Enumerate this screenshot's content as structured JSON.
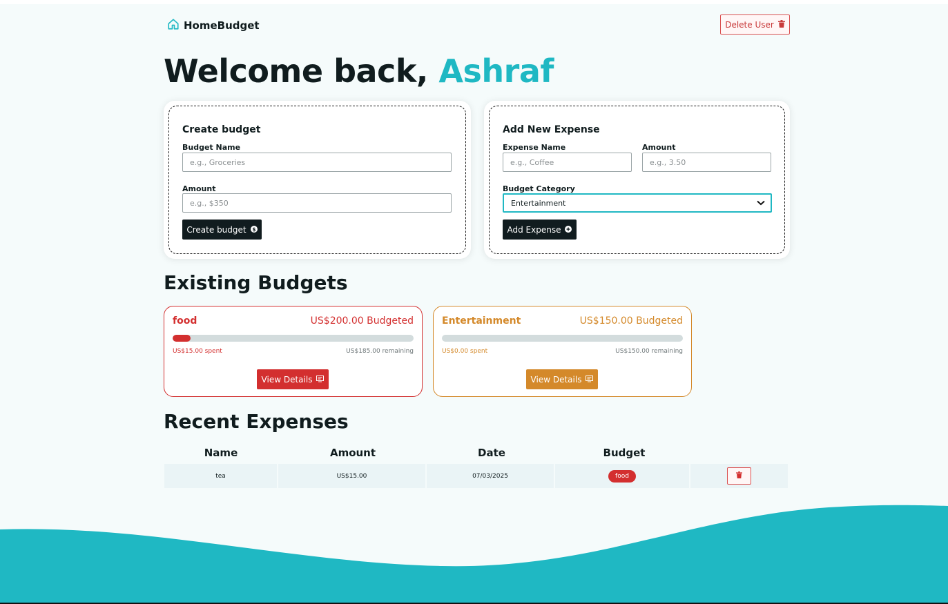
{
  "app": {
    "brand": "HomeBudget",
    "accent_color": "#1fb8c3"
  },
  "header": {
    "delete_user_label": "Delete User"
  },
  "welcome": {
    "prefix": "Welcome back,",
    "user_name": "Ashraf"
  },
  "create_budget": {
    "title": "Create budget",
    "name_label": "Budget Name",
    "name_placeholder": "e.g., Groceries",
    "amount_label": "Amount",
    "amount_placeholder": "e.g., $350",
    "submit_label": "Create budget"
  },
  "add_expense": {
    "title": "Add New Expense",
    "name_label": "Expense Name",
    "name_placeholder": "e.g., Coffee",
    "amount_label": "Amount",
    "amount_placeholder": "e.g., 3.50",
    "category_label": "Budget Category",
    "category_selected": "Entertainment",
    "submit_label": "Add Expense"
  },
  "existing_budgets": {
    "heading": "Existing Budgets",
    "budgets": [
      {
        "name": "food",
        "budgeted": "US$200.00 Budgeted",
        "spent": "US$15.00 spent",
        "remaining": "US$185.00 remaining",
        "progress": 0.075,
        "color": "#d32f2f",
        "button_label": "View Details"
      },
      {
        "name": "Entertainment",
        "budgeted": "US$150.00 Budgeted",
        "spent": "US$0.00 spent",
        "remaining": "US$150.00 remaining",
        "progress": 0.0,
        "color": "#d4892a",
        "button_label": "View Details"
      }
    ]
  },
  "recent_expenses": {
    "heading": "Recent Expenses",
    "columns": [
      "Name",
      "Amount",
      "Date",
      "Budget"
    ],
    "rows": [
      {
        "name": "tea",
        "amount": "US$15.00",
        "date": "07/03/2025",
        "budget": "food"
      }
    ]
  }
}
